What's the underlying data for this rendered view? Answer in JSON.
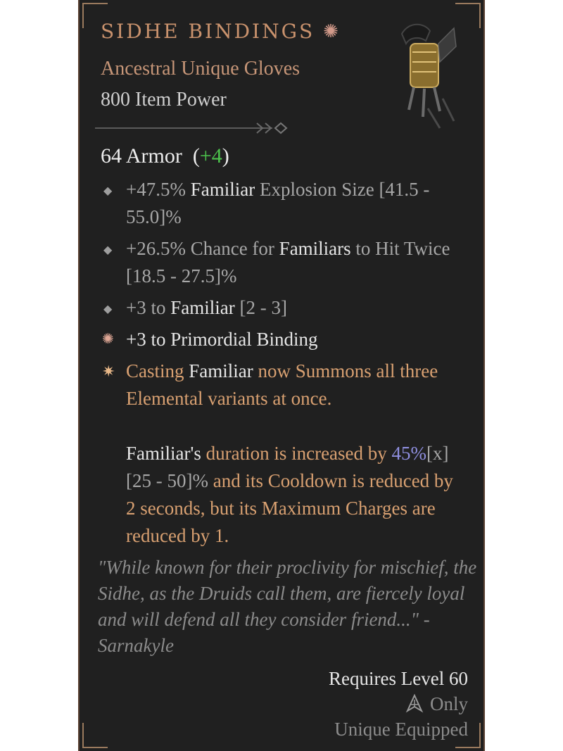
{
  "item": {
    "name": "SIDHE BINDINGS",
    "type": "Ancestral Unique Gloves",
    "power": "800 Item Power",
    "icon": "unique-flower-icon",
    "art": "gloves-image"
  },
  "armor": {
    "label": "64 Armor",
    "bonus_open": "(",
    "bonus": "+4",
    "bonus_close": ")"
  },
  "affixes": [
    {
      "bullet": "diamond-bullet-icon",
      "parts": [
        "+47.5% ",
        "Familiar",
        " Explosion Size [41.5 - 55.0]%"
      ]
    },
    {
      "bullet": "diamond-bullet-icon",
      "parts": [
        "+26.5% Chance for ",
        "Familiars",
        " to Hit Twice [18.5 - 27.5]%"
      ]
    },
    {
      "bullet": "diamond-bullet-icon",
      "parts": [
        "+3 to ",
        "Familiar",
        " [2 - 3]"
      ]
    },
    {
      "bullet": "unique-flower-icon",
      "parts": [
        "+3 to Primordial Binding"
      ]
    }
  ],
  "legendary": {
    "bullet": "star-bullet-icon",
    "p1": [
      "Casting ",
      "Familiar",
      " now Summons all three Elemental variants at once."
    ],
    "p2": [
      "Familiar's",
      " duration is increased by ",
      "45%",
      "[x]",
      " [25 - 50]% ",
      "and its Cooldown is reduced by 2 seconds, but its Maximum Charges are reduced by 1."
    ]
  },
  "flavor": "\"While known for their proclivity for mischief, the Sidhe, as the Druids call them, are fiercely loyal and will defend all they consider friend...\"  - Sarnakyle",
  "requirements": {
    "level": "Requires Level 60",
    "class_only": "Only",
    "class_icon": "druid-class-icon",
    "unique_equipped": "Unique Equipped"
  },
  "colors": {
    "name": "#c9926d",
    "legendary": "#d8a071",
    "bonus": "#4cc34c",
    "value_highlight": "#8f8fe0",
    "background": "#202020"
  }
}
